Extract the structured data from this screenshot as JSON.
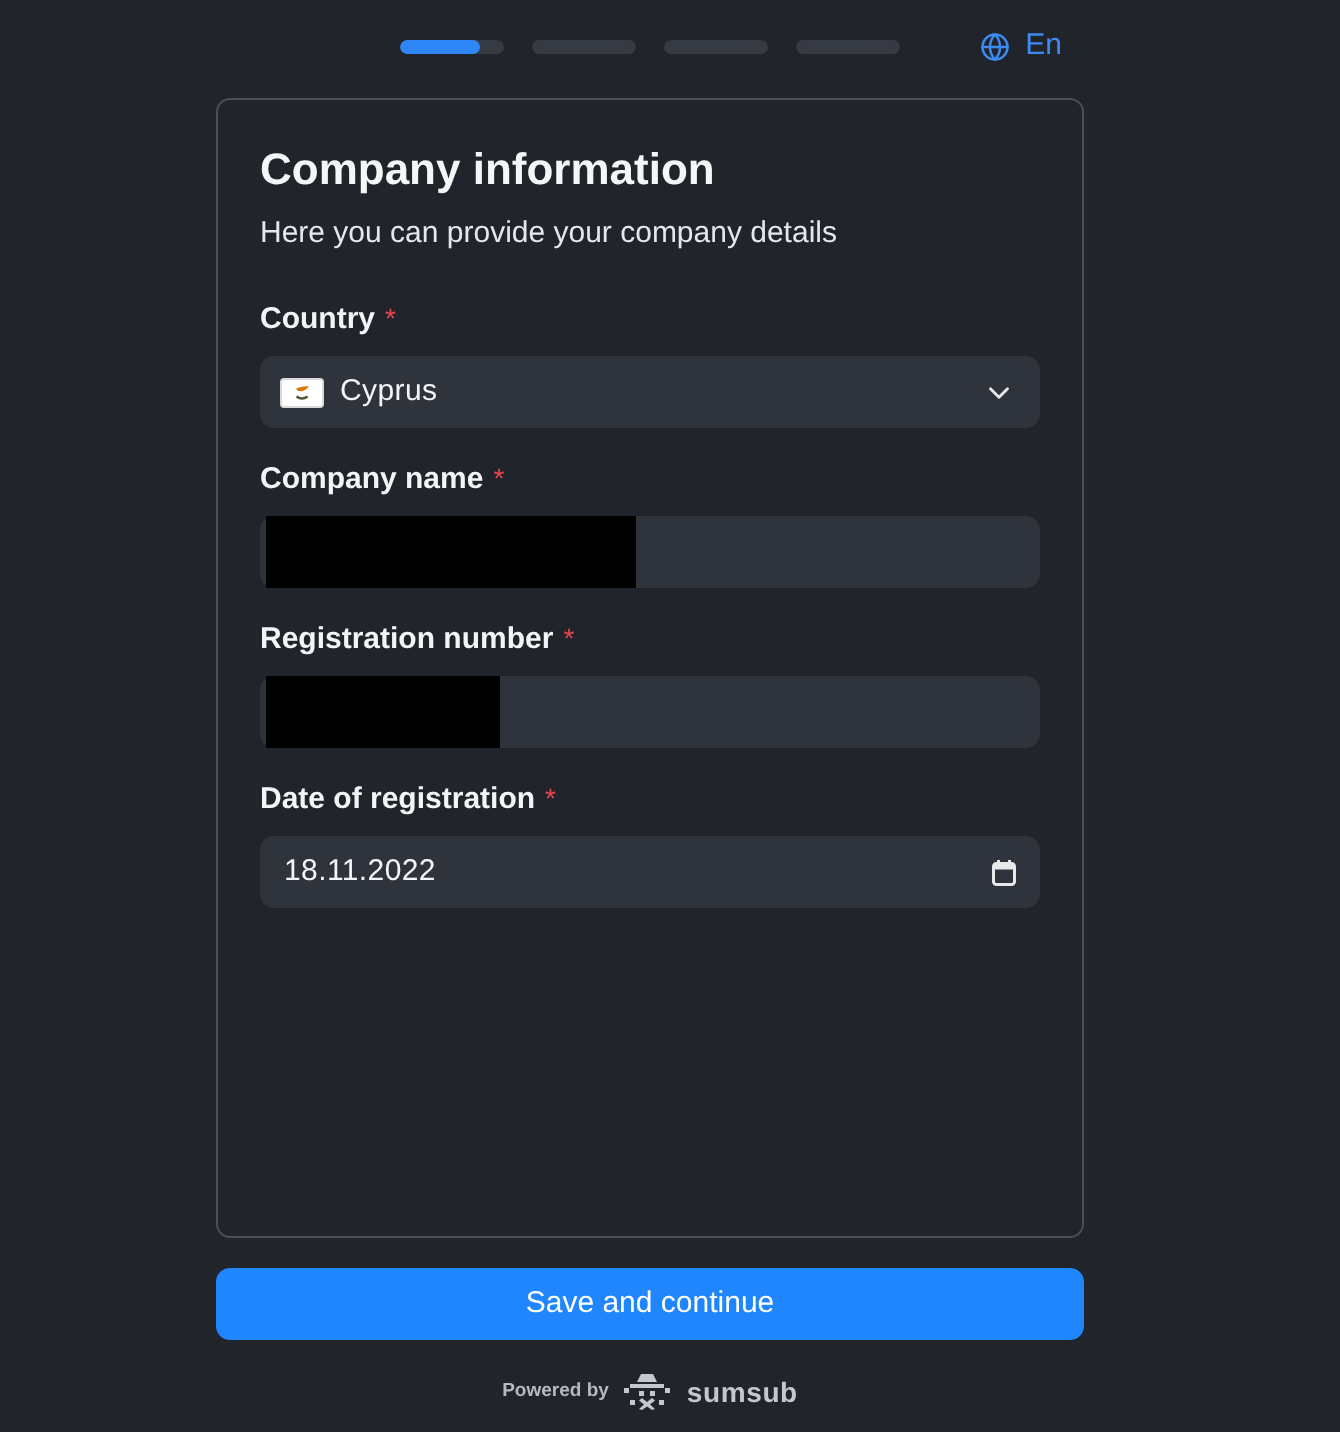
{
  "progress_steps": [
    {
      "kind": "current",
      "level": 0.77
    },
    {
      "kind": "upcoming"
    },
    {
      "kind": "upcoming"
    },
    {
      "kind": "upcoming"
    }
  ],
  "language": {
    "label": "En"
  },
  "form": {
    "title": "Company information",
    "subtitle": "Here you can provide your company details",
    "fields": [
      {
        "kind": "select",
        "label": "Country",
        "required_mark": "*",
        "value": "Cyprus"
      },
      {
        "kind": "text",
        "label": "Company name",
        "required_mark": "*",
        "redacted": true
      },
      {
        "kind": "text",
        "label": "Registration number",
        "required_mark": "*",
        "redacted": true
      },
      {
        "kind": "date",
        "label": "Date of registration",
        "required_mark": "*",
        "value": "18.11.2022"
      }
    ]
  },
  "primary_button": {
    "label": "Save and continue"
  },
  "footer": {
    "powered_by": "Powered by",
    "brand": "sumsub"
  }
}
